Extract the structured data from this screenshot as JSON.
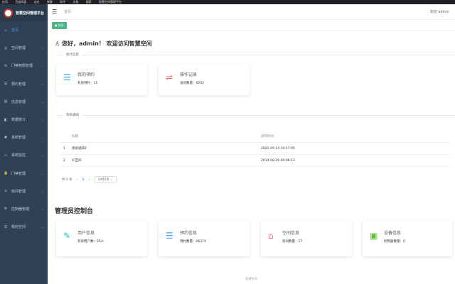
{
  "bookmarks": [
    "应用",
    "百度网盘",
    "必应",
    "博客",
    "知乎",
    "文档",
    "搜索",
    "智慧空间管理平台"
  ],
  "brand": {
    "title": "智慧空间管理平台"
  },
  "sidebar": {
    "items": [
      {
        "label": "首页",
        "icon": "⌂"
      },
      {
        "label": "空间管理",
        "icon": "◎"
      },
      {
        "label": "门禁权限管理",
        "icon": "⇆"
      },
      {
        "label": "预约管理",
        "icon": "☰"
      },
      {
        "label": "信息管理",
        "icon": "▤"
      },
      {
        "label": "数据统计",
        "icon": "◧"
      },
      {
        "label": "系统管理",
        "icon": "✱"
      },
      {
        "label": "系统监控",
        "icon": "▭"
      },
      {
        "label": "门禁管理",
        "icon": "🔒"
      },
      {
        "label": "房间管理",
        "icon": "⌂"
      },
      {
        "label": "控制器管理",
        "icon": "⚙"
      },
      {
        "label": "我的空间",
        "icon": "☰"
      }
    ]
  },
  "header": {
    "breadcrumb": "首页",
    "welcome": "欢迎 admin"
  },
  "tags": {
    "home": "● 首页"
  },
  "greeting": "您好，admin！ 欢迎访问智慧空间",
  "stats": {
    "section_title": "统计信息",
    "cards": [
      {
        "title": "我的预约",
        "value": "有效预约：11",
        "icon": "☰",
        "color": "#409eff"
      },
      {
        "title": "操作记录",
        "value": "访问数量：0202",
        "icon": "⇌",
        "color": "#f56c6c"
      }
    ]
  },
  "notices": {
    "section_title": "系统通知",
    "columns": [
      "",
      "标题",
      "发布时间"
    ],
    "rows": [
      {
        "no": "1",
        "title": "测试通知2",
        "time": "2021-09-14 10:57:05"
      },
      {
        "no": "2",
        "title": "IC空间",
        "time": "2014-08-26 00:06:13"
      }
    ],
    "pager": {
      "total": "共 2 条",
      "prev": "‹",
      "page": "1",
      "next": "›",
      "size": "10条/页 ⌄"
    }
  },
  "console": {
    "title": "管理员控制台",
    "cards": [
      {
        "title": "用户信息",
        "value": "有效用户数：55人",
        "icon": "✎",
        "color": "#13c2c2"
      },
      {
        "title": "预约信息",
        "value": "预约数量：26374",
        "icon": "☰",
        "color": "#409eff"
      },
      {
        "title": "空间信息",
        "value": "房间数量：17",
        "icon": "⌂",
        "color": "#f56c6c"
      },
      {
        "title": "设备信息",
        "value": "控制器数量：0",
        "icon": "▣",
        "color": "#52c41a"
      }
    ]
  },
  "footer": "智慧空间"
}
